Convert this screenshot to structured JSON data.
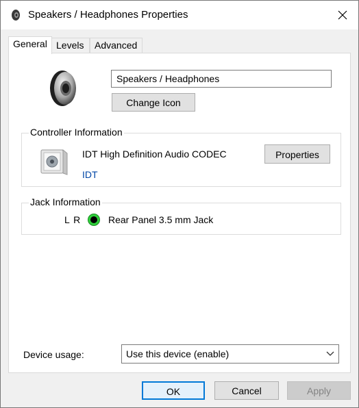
{
  "window": {
    "title": "Speakers / Headphones Properties",
    "title_icon": "speaker-icon",
    "close_icon": "close-icon"
  },
  "tabs": [
    {
      "label": "General",
      "active": true
    },
    {
      "label": "Levels",
      "active": false
    },
    {
      "label": "Advanced",
      "active": false
    }
  ],
  "general": {
    "device_name": "Speakers / Headphones",
    "device_icon": "speaker-icon",
    "change_icon_label": "Change Icon",
    "controller": {
      "heading": "Controller Information",
      "name": "IDT High Definition Audio CODEC",
      "vendor": "IDT",
      "properties_label": "Properties",
      "icon": "audio-device-icon"
    },
    "jack": {
      "heading": "Jack Information",
      "channels": "L R",
      "color": "#2fcf3b",
      "description": "Rear Panel 3.5 mm Jack"
    },
    "device_usage": {
      "label": "Device usage:",
      "selected": "Use this device (enable)"
    }
  },
  "footer": {
    "ok_label": "OK",
    "cancel_label": "Cancel",
    "apply_label": "Apply",
    "apply_enabled": false
  }
}
